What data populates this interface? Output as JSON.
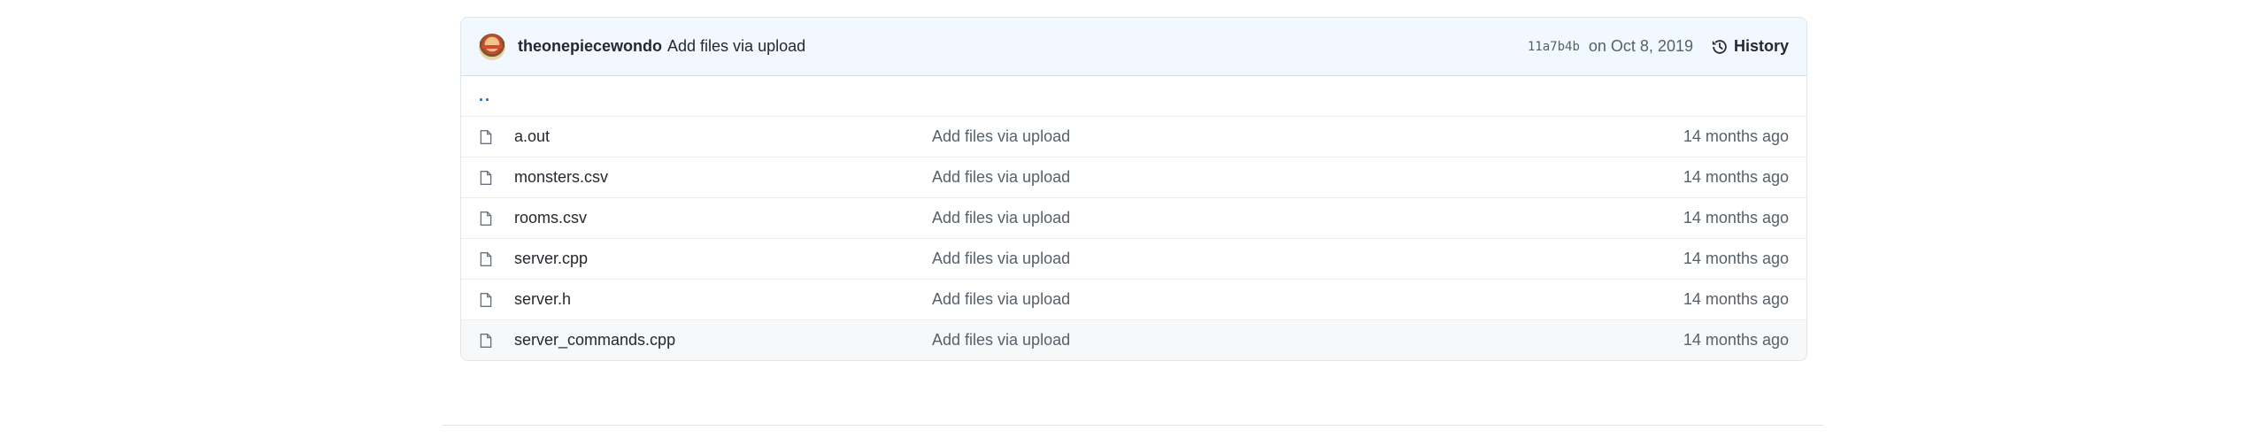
{
  "commit": {
    "author": "theonepiecewondo",
    "message": "Add files via upload",
    "sha": "11a7b4b",
    "date": "on Oct 8, 2019",
    "history_label": "History"
  },
  "parent_dir": "..",
  "files": [
    {
      "name": "a.out",
      "message": "Add files via upload",
      "age": "14 months ago",
      "icon": "file-icon"
    },
    {
      "name": "monsters.csv",
      "message": "Add files via upload",
      "age": "14 months ago",
      "icon": "file-icon"
    },
    {
      "name": "rooms.csv",
      "message": "Add files via upload",
      "age": "14 months ago",
      "icon": "file-icon"
    },
    {
      "name": "server.cpp",
      "message": "Add files via upload",
      "age": "14 months ago",
      "icon": "file-icon"
    },
    {
      "name": "server.h",
      "message": "Add files via upload",
      "age": "14 months ago",
      "icon": "file-icon"
    },
    {
      "name": "server_commands.cpp",
      "message": "Add files via upload",
      "age": "14 months ago",
      "icon": "file-icon"
    }
  ],
  "colors": {
    "header_bg": "#f1f8ff",
    "link_blue": "#0366d6",
    "muted_text": "#586069",
    "border": "#e1e4e8"
  }
}
